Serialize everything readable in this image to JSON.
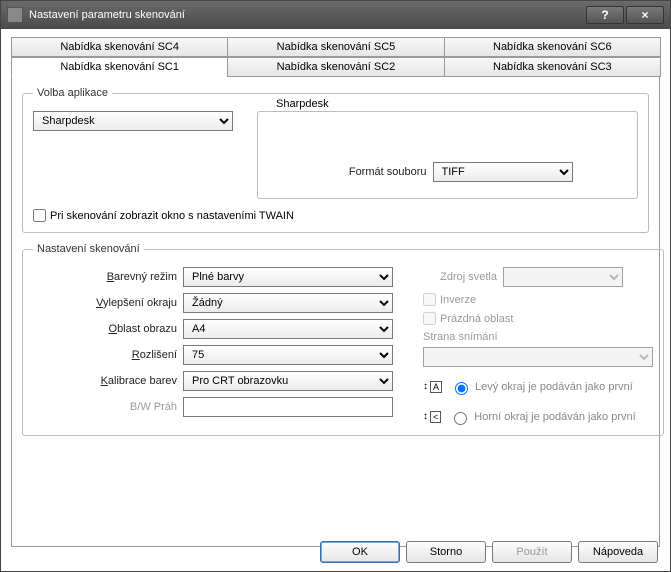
{
  "window": {
    "title": "Nastavení parametru skenování"
  },
  "tabs": {
    "row1": [
      "Nabídka skenování SC4",
      "Nabídka skenování SC5",
      "Nabídka skenování SC6"
    ],
    "row2": [
      "Nabídka skenování SC1",
      "Nabídka skenování SC2",
      "Nabídka skenování SC3"
    ],
    "active": "Nabídka skenování SC1"
  },
  "appChoice": {
    "legend": "Volba aplikace",
    "appSelect": "Sharpdesk",
    "subTitle": "Sharpdesk",
    "fileFormatLabel": "Formát souboru",
    "fileFormat": "TIFF",
    "twainCheckbox": "Pri skenování zobrazit okno s nastaveními TWAIN"
  },
  "scanSettings": {
    "legend": "Nastavení skenování",
    "labels": {
      "colorMode": "Barevný režim",
      "edgeEnhance": "Vylepšení okraju",
      "scanArea": "Oblast obrazu",
      "resolution": "Rozlišení",
      "colorCal": "Kalibrace barev",
      "bwThreshold": "B/W Práh",
      "lightSource": "Zdroj svetla",
      "invert": "Inverze",
      "blankArea": "Prázdná oblast",
      "scanSide": "Strana snímání"
    },
    "values": {
      "colorMode": "Plné barvy",
      "edgeEnhance": "Žádný",
      "scanArea": "A4",
      "resolution": "75",
      "colorCal": "Pro CRT obrazovku",
      "bwThreshold": "",
      "lightSource": "",
      "scanSide": ""
    },
    "radios": {
      "leftFirst": "Levý okraj je podáván jako první",
      "topFirst": "Horní okraj je podáván jako první"
    }
  },
  "footer": {
    "ok": "OK",
    "cancel": "Storno",
    "apply": "Použít",
    "help": "Nápoveda"
  }
}
